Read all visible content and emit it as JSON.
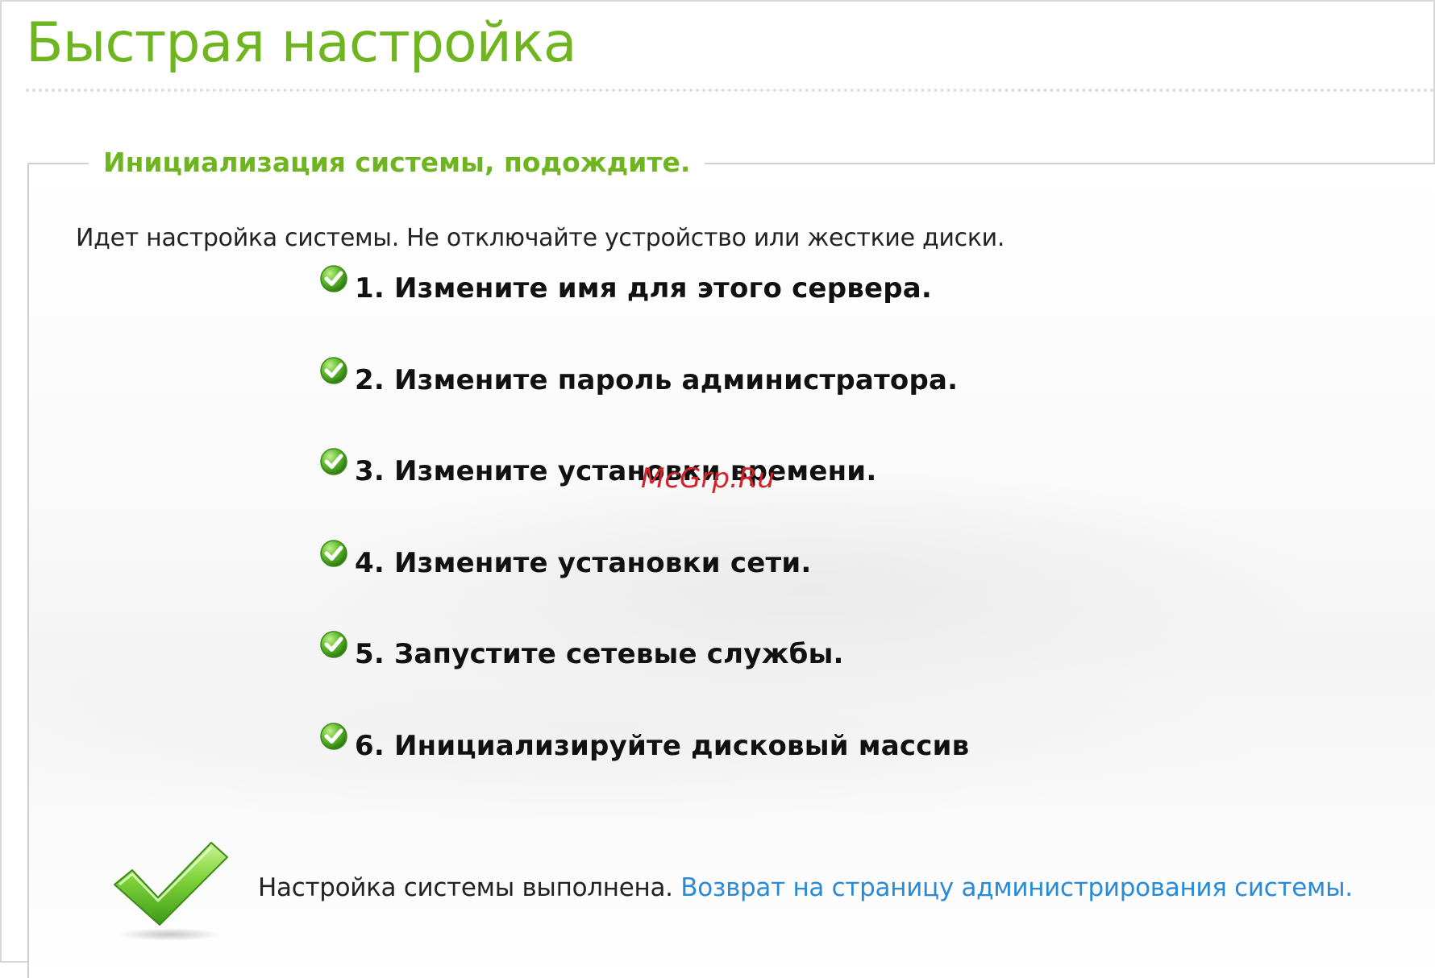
{
  "page": {
    "title": "Быстрая настройка"
  },
  "panel": {
    "legend": "Инициализация системы, подождите.",
    "intro": "Идет настройка системы. Не отключайте устройство или жесткие диски.",
    "steps": [
      {
        "label": "1. Измените имя для этого сервера.",
        "icon": "check-circle-icon",
        "status": "done"
      },
      {
        "label": "2. Измените пароль администратора.",
        "icon": "check-circle-icon",
        "status": "done"
      },
      {
        "label": "3. Измените установки времени.",
        "icon": "check-circle-icon",
        "status": "done"
      },
      {
        "label": "4. Измените установки сети.",
        "icon": "check-circle-icon",
        "status": "done"
      },
      {
        "label": "5. Запустите сетевые службы.",
        "icon": "check-circle-icon",
        "status": "done"
      },
      {
        "label": "6. Инициализируйте дисковый массив",
        "icon": "check-circle-icon",
        "status": "done"
      }
    ],
    "completion": {
      "icon": "large-checkmark-icon",
      "status_text": "Настройка системы выполнена.",
      "link_text": "Возврат на страницу администрирования системы."
    }
  },
  "watermark": "McGrp.Ru",
  "colors": {
    "title_green": "#6fb51f",
    "link_blue": "#2a8ad8",
    "check_green": "#5cb82a",
    "watermark_red": "#d0232a"
  }
}
